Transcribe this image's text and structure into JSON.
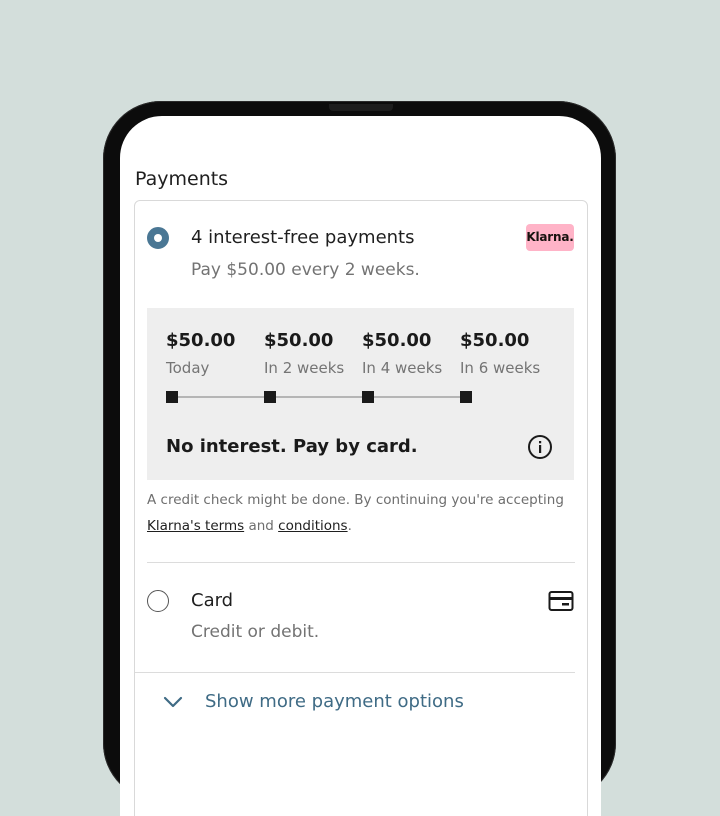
{
  "section_title": "Payments",
  "klarna_option": {
    "title": "4 interest-free payments",
    "subtitle": "Pay $50.00 every 2 weeks.",
    "brand_badge": "Klarna.",
    "selected": true,
    "installments": [
      {
        "amount": "$50.00",
        "label": "Today"
      },
      {
        "amount": "$50.00",
        "label": "In 2 weeks"
      },
      {
        "amount": "$50.00",
        "label": "In 4 weeks"
      },
      {
        "amount": "$50.00",
        "label": "In 6 weeks"
      }
    ],
    "notice": "No interest. Pay by card.",
    "disclaimer": {
      "prefix": "A credit check might be done. By continuing you're accepting ",
      "terms_link": "Klarna's terms",
      "middle": " and ",
      "conditions_link": "conditions",
      "suffix": "."
    }
  },
  "card_option": {
    "title": "Card",
    "subtitle": "Credit or debit.",
    "selected": false
  },
  "more_options_label": "Show more payment options",
  "colors": {
    "background": "#d3dedb",
    "accent": "#4a7794",
    "klarna_pink": "#ffb3c7",
    "link_blue": "#3f6b85"
  },
  "icons": [
    "info-icon",
    "credit-card-icon",
    "chevron-down-icon"
  ]
}
